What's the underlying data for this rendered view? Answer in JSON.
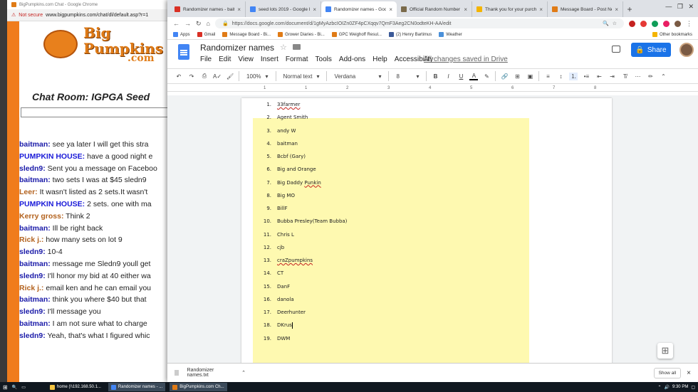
{
  "chat_window": {
    "title": "BigPumpkins.com Chat - Google Chrome",
    "not_secure": "Not secure",
    "url": "www.bigpumpkins.com/chat/dl/default.asp?r=1",
    "logo_line1": "Big",
    "logo_line2": "Pumpkins",
    "logo_line3": ".com",
    "room_title": "Chat Room: IGPGA Seed",
    "messages": [
      {
        "user": "baitman:",
        "text": " see ya later I will get this stra",
        "color": "#1a1aa8"
      },
      {
        "user": "PUMPKIN HOUSE:",
        "text": " have a good night e",
        "color": "#1a1ad8"
      },
      {
        "user": "sledn9:",
        "text": " Sent you a message on Faceboo",
        "color": "#1a1aa8"
      },
      {
        "user": "baitman:",
        "text": " two sets I was at $45 sledn9",
        "color": "#1a1aa8"
      },
      {
        "user": "Leer:",
        "text": " It wasn't listed as 2 sets.It wasn't",
        "color": "#b3621e"
      },
      {
        "user": "PUMPKIN HOUSE:",
        "text": " 2 sets. one with ma",
        "color": "#1a1ad8"
      },
      {
        "user": "Kerry gross:",
        "text": " Think 2",
        "color": "#b3621e"
      },
      {
        "user": "baitman:",
        "text": " Ill be right back",
        "color": "#1a1aa8"
      },
      {
        "user": "Rick j.:",
        "text": " how many sets on lot 9",
        "color": "#b3621e"
      },
      {
        "user": "sledn9:",
        "text": " 10-4",
        "color": "#1a1aa8"
      },
      {
        "user": "baitman:",
        "text": " message me Sledn9 youll get",
        "color": "#1a1aa8"
      },
      {
        "user": "sledn9:",
        "text": " I'll honor my bid at 40 either wa",
        "color": "#1a1aa8"
      },
      {
        "user": "Rick j.:",
        "text": " email ken and he can email you",
        "color": "#b3621e"
      },
      {
        "user": "baitman:",
        "text": " think you where $40 but that",
        "color": "#1a1aa8"
      },
      {
        "user": "sledn9:",
        "text": " I'll message you",
        "color": "#1a1aa8"
      },
      {
        "user": "baitman:",
        "text": " I am not sure what to charge",
        "color": "#1a1aa8"
      },
      {
        "user": "sledn9:",
        "text": " Yeah, that's what I figured whic",
        "color": "#1a1aa8"
      }
    ]
  },
  "browser": {
    "tabs": [
      {
        "label": "Randomizer names - baitm",
        "icon_color": "#d93025"
      },
      {
        "label": "seed lots 2019 - Google D",
        "icon_color": "#4285f4"
      },
      {
        "label": "Randomizer names - Goog",
        "icon_color": "#4285f4"
      },
      {
        "label": "Official Random Number G",
        "icon_color": "#7a6a4a"
      },
      {
        "label": "Thank you for your purcha",
        "icon_color": "#f4b400"
      },
      {
        "label": "Message Board - Post New",
        "icon_color": "#e07b16"
      }
    ],
    "url": "https://docs.google.com/document/d/1gMyAzbcIOIZn0ZF4pCXqqv7QmF3Aeg2CN0odteKH-AA/edit",
    "bookmarks": [
      "Apps",
      "Gmail",
      "Message Board - Bi...",
      "Grower Diaries - Bi...",
      "GPC Weighoff Resul...",
      "(2) Henry Bartimus",
      "Weather",
      "Other bookmarks"
    ],
    "new_tab": "+",
    "close_x": "×"
  },
  "docs": {
    "title": "Randomizer names",
    "menu": [
      "File",
      "Edit",
      "View",
      "Insert",
      "Format",
      "Tools",
      "Add-ons",
      "Help",
      "Accessibility"
    ],
    "saved_status": "All changes saved in Drive",
    "share_label": "Share",
    "zoom": "100%",
    "style": "Normal text",
    "font": "Verdana",
    "font_size": "8",
    "ruler_marks": [
      "1",
      "1",
      "2",
      "3",
      "4",
      "5",
      "6",
      "7",
      "8"
    ],
    "list": [
      {
        "n": "1.",
        "name": "33farmer",
        "spell": true
      },
      {
        "n": "2.",
        "name": "Agent Smith"
      },
      {
        "n": "3.",
        "name": "andy W"
      },
      {
        "n": "4.",
        "name": "baitman"
      },
      {
        "n": "5.",
        "name": "Bcbf (Gary)"
      },
      {
        "n": "6.",
        "name": "Big and Orange"
      },
      {
        "n": "7.",
        "name": "Big Daddy ",
        "tail": "Punkin",
        "spell_tail": true
      },
      {
        "n": "8.",
        "name": "Big MO"
      },
      {
        "n": "9.",
        "name": "BillF"
      },
      {
        "n": "10.",
        "name": "Bubba Presley(Team Bubba)"
      },
      {
        "n": "11.",
        "name": "Chris L"
      },
      {
        "n": "12.",
        "name": "cjb"
      },
      {
        "n": "13.",
        "name": "craZpumpkins",
        "spell": true
      },
      {
        "n": "14.",
        "name": "CT"
      },
      {
        "n": "15.",
        "name": "DanF"
      },
      {
        "n": "16.",
        "name": "danola"
      },
      {
        "n": "17.",
        "name": "Deerhunter"
      },
      {
        "n": "18.",
        "name": "DKrus",
        "caret": true
      },
      {
        "n": "19.",
        "name": "DWM"
      }
    ],
    "highlight_color": "#fef9b0"
  },
  "downloads": {
    "file": "Randomizer names.txt",
    "show_all": "Show all"
  },
  "taskbar": {
    "items": [
      "home (\\\\192.168.50.1...",
      "Randomizer names - ...",
      "BigPumpkins.com Ch..."
    ],
    "time": "9:30 PM"
  }
}
